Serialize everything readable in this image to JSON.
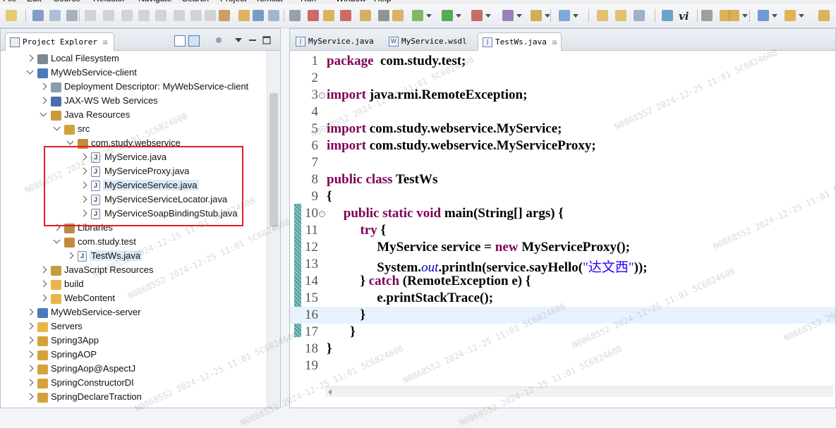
{
  "menu": [
    "File",
    "Edit",
    "Source",
    "Refactor",
    "Navigate",
    "Search",
    "Project",
    "Tomcat",
    "Run",
    "Window",
    "Help"
  ],
  "colors": {
    "selection": "#dcebf8",
    "highlight_box": "#e02020",
    "keyword": "#7f0055",
    "string": "#2a00ff",
    "static_field": "#0000c0"
  },
  "toolbar": {
    "italic_label": "vi",
    "icons": [
      "new-icon",
      "save-icon",
      "save-all-icon",
      "print-icon",
      "debug-icon",
      "run-icon",
      "external-tools-icon",
      "search-icon",
      "open-type-icon",
      "pin-icon",
      "next-annotation-icon",
      "back-icon",
      "forward-icon"
    ]
  },
  "explorer": {
    "tab_title": "Project Explorer",
    "tree": [
      {
        "label": "Local Filesystem",
        "icon": "filesystem-icon",
        "depth": 0,
        "state": "closed"
      },
      {
        "label": "MyWebService-client",
        "icon": "web-project-icon",
        "depth": 0,
        "state": "open"
      },
      {
        "label": "Deployment Descriptor: MyWebService-client",
        "icon": "descriptor-icon",
        "depth": 1,
        "state": "closed"
      },
      {
        "label": "JAX-WS Web Services",
        "icon": "webservice-icon",
        "depth": 1,
        "state": "closed"
      },
      {
        "label": "Java Resources",
        "icon": "java-resources-icon",
        "depth": 1,
        "state": "open"
      },
      {
        "label": "src",
        "icon": "source-folder-icon",
        "depth": 2,
        "state": "open"
      },
      {
        "label": "com.study.webservice",
        "icon": "package-icon",
        "depth": 3,
        "state": "open"
      },
      {
        "label": "MyService.java",
        "icon": "java-file-icon",
        "depth": 4,
        "state": "closed"
      },
      {
        "label": "MyServiceProxy.java",
        "icon": "java-file-icon",
        "depth": 4,
        "state": "closed"
      },
      {
        "label": "MyServiceService.java",
        "icon": "java-file-icon",
        "depth": 4,
        "state": "closed",
        "selected": true
      },
      {
        "label": "MyServiceServiceLocator.java",
        "icon": "java-file-icon",
        "depth": 4,
        "state": "closed"
      },
      {
        "label": "MyServiceSoapBindingStub.java",
        "icon": "java-file-icon",
        "depth": 4,
        "state": "closed"
      },
      {
        "label": "Libraries",
        "icon": "libraries-icon",
        "depth": 2,
        "state": "closed"
      },
      {
        "label": "com.study.test",
        "icon": "package-icon",
        "depth": 2,
        "state": "open"
      },
      {
        "label": "TestWs.java",
        "icon": "java-file-icon",
        "depth": 3,
        "state": "closed",
        "selected": true
      },
      {
        "label": "JavaScript Resources",
        "icon": "js-resources-icon",
        "depth": 1,
        "state": "closed"
      },
      {
        "label": "build",
        "icon": "folder-icon",
        "depth": 1,
        "state": "closed"
      },
      {
        "label": "WebContent",
        "icon": "folder-icon",
        "depth": 1,
        "state": "closed"
      },
      {
        "label": "MyWebService-server",
        "icon": "web-project-icon",
        "depth": 0,
        "state": "closed"
      },
      {
        "label": "Servers",
        "icon": "folder-icon",
        "depth": 0,
        "state": "closed"
      },
      {
        "label": "Spring3App",
        "icon": "spring-project-icon",
        "depth": 0,
        "state": "closed"
      },
      {
        "label": "SpringAOP",
        "icon": "spring-project-icon",
        "depth": 0,
        "state": "closed"
      },
      {
        "label": "SpringAop@AspectJ",
        "icon": "spring-project-icon",
        "depth": 0,
        "state": "closed"
      },
      {
        "label": "SpringConstructorDI",
        "icon": "spring-project-icon",
        "depth": 0,
        "state": "closed"
      },
      {
        "label": "SpringDeclareTraction",
        "icon": "spring-project-icon",
        "depth": 0,
        "state": "closed"
      }
    ]
  },
  "editor": {
    "tabs": [
      {
        "label": "MyService.java",
        "icon": "java-file-icon",
        "active": false
      },
      {
        "label": "MyService.wsdl",
        "icon": "wsdl-file-icon",
        "active": false
      },
      {
        "label": "TestWs.java",
        "icon": "java-file-icon",
        "active": true
      }
    ],
    "current_line": 16,
    "lines": [
      {
        "n": "1",
        "fold": false,
        "segs": [
          [
            "kw",
            "package"
          ],
          [
            "",
            "  com.study.test;"
          ]
        ]
      },
      {
        "n": "2",
        "fold": false,
        "segs": []
      },
      {
        "n": "3",
        "fold": true,
        "segs": [
          [
            "kw",
            "import"
          ],
          [
            "",
            " java.rmi.RemoteException;"
          ]
        ]
      },
      {
        "n": "4",
        "fold": false,
        "segs": []
      },
      {
        "n": "5",
        "fold": false,
        "segs": [
          [
            "kw",
            "import"
          ],
          [
            "",
            " com.study.webservice.MyService;"
          ]
        ]
      },
      {
        "n": "6",
        "fold": false,
        "segs": [
          [
            "kw",
            "import"
          ],
          [
            "",
            " com.study.webservice.MyServiceProxy;"
          ]
        ]
      },
      {
        "n": "7",
        "fold": false,
        "segs": []
      },
      {
        "n": "8",
        "fold": false,
        "segs": [
          [
            "kw",
            "public class"
          ],
          [
            "",
            " TestWs"
          ]
        ]
      },
      {
        "n": "9",
        "fold": false,
        "segs": [
          [
            "",
            "{"
          ]
        ]
      },
      {
        "n": "10",
        "fold": true,
        "segs": [
          [
            "",
            "     "
          ],
          [
            "kw",
            "public static void"
          ],
          [
            "",
            " main(String[] args) {"
          ]
        ]
      },
      {
        "n": "11",
        "fold": false,
        "segs": [
          [
            "",
            "          "
          ],
          [
            "kw",
            "try"
          ],
          [
            "",
            " {"
          ]
        ]
      },
      {
        "n": "12",
        "fold": false,
        "segs": [
          [
            "",
            "               MyService service = "
          ],
          [
            "kw",
            "new"
          ],
          [
            "",
            " MyServiceProxy();"
          ]
        ]
      },
      {
        "n": "13",
        "fold": false,
        "segs": [
          [
            "",
            "               System."
          ],
          [
            "it",
            "out"
          ],
          [
            "",
            ".println(service.sayHello("
          ],
          [
            "str",
            "\"达文西\""
          ],
          [
            "",
            "));"
          ]
        ]
      },
      {
        "n": "14",
        "fold": false,
        "segs": [
          [
            "",
            "          } "
          ],
          [
            "kw",
            "catch"
          ],
          [
            "",
            " (RemoteException e) {"
          ]
        ]
      },
      {
        "n": "15",
        "fold": false,
        "segs": [
          [
            "",
            "               e.printStackTrace();"
          ]
        ]
      },
      {
        "n": "16",
        "fold": false,
        "segs": [
          [
            "",
            "          }"
          ]
        ]
      },
      {
        "n": "17",
        "fold": false,
        "segs": [
          [
            "",
            "       }"
          ]
        ]
      },
      {
        "n": "18",
        "fold": false,
        "segs": [
          [
            "",
            "}"
          ]
        ]
      },
      {
        "n": "19",
        "fold": false,
        "segs": []
      }
    ]
  },
  "watermark": "N0868552 2024-12-25 11:01 5C6824608"
}
